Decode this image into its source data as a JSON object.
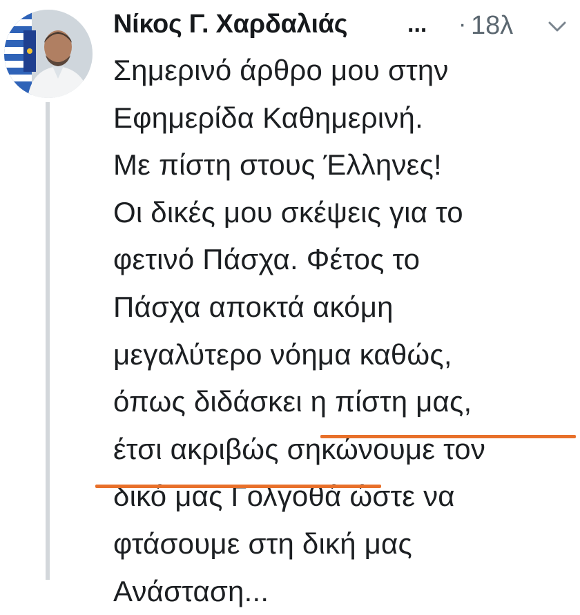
{
  "tweet": {
    "author_name": "Νίκος Γ. Χαρδαλιάς",
    "truncation": "...",
    "separator": "·",
    "time": "18λ",
    "lines": [
      "Σημερινό άρθρο μου στην",
      "Εφημερίδα Καθημερινή.",
      "Με πίστη στους Έλληνες!",
      "Οι δικές μου σκέψεις για το",
      "φετινό Πάσχα. Φέτος το",
      "Πάσχα αποκτά ακόμη",
      "μεγαλύτερο νόημα καθώς,",
      "όπως διδάσκει η πίστη μας,",
      "έτσι ακριβώς σηκώνουμε τον",
      "δικό μας Γολγοθά ώστε να",
      "φτάσουμε στη δική μας",
      "Ανάσταση..."
    ]
  },
  "colors": {
    "highlight_underline": "#e8702a",
    "thread_line": "#d3d7db",
    "meta_text": "#5b6770"
  },
  "icons": {
    "avatar": "profile-photo",
    "menu": "chevron-down-icon"
  }
}
